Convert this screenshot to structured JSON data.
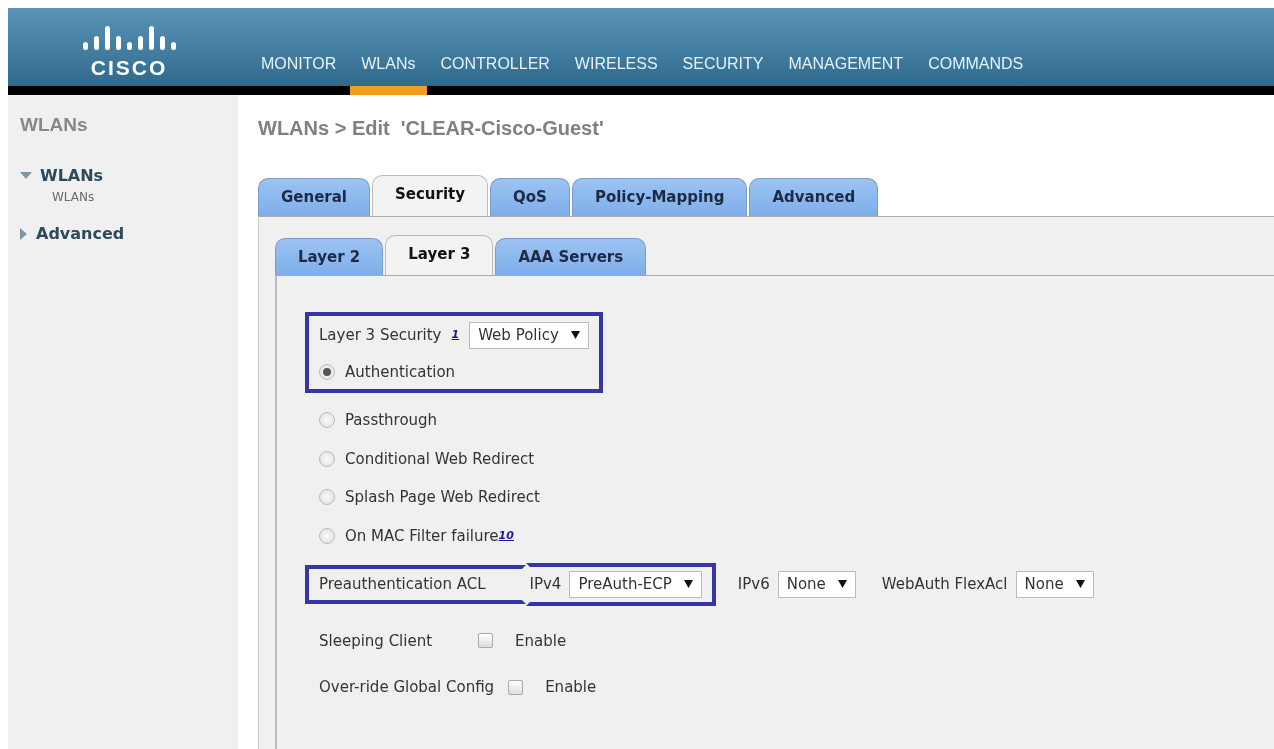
{
  "header": {
    "logo": "CISCO",
    "menu": [
      {
        "label": "MONITOR",
        "selected": false
      },
      {
        "label": "WLANs",
        "selected": true
      },
      {
        "label": "CONTROLLER",
        "selected": false
      },
      {
        "label": "WIRELESS",
        "selected": false
      },
      {
        "label": "SECURITY",
        "selected": false
      },
      {
        "label": "MANAGEMENT",
        "selected": false
      },
      {
        "label": "COMMANDS",
        "selected": false
      }
    ]
  },
  "sidebar": {
    "title": "WLANs",
    "items": [
      {
        "label": "WLANs",
        "expanded": true,
        "children": [
          {
            "label": "WLANs"
          }
        ]
      },
      {
        "label": "Advanced",
        "expanded": false
      }
    ]
  },
  "page_title": "WLANs > Edit  'CLEAR-Cisco-Guest'",
  "tabs": [
    {
      "label": "General",
      "selected": false
    },
    {
      "label": "Security",
      "selected": true
    },
    {
      "label": "QoS",
      "selected": false
    },
    {
      "label": "Policy-Mapping",
      "selected": false
    },
    {
      "label": "Advanced",
      "selected": false
    }
  ],
  "subtabs": [
    {
      "label": "Layer 2",
      "selected": false
    },
    {
      "label": "Layer 3",
      "selected": true
    },
    {
      "label": "AAA Servers",
      "selected": false
    }
  ],
  "form": [
    {
      "kind": "select",
      "label": "Layer 3 Security",
      "footnote": "1",
      "value": "Web Policy",
      "highlighted": true
    },
    {
      "kind": "radio",
      "label": "Authentication",
      "selected": true,
      "highlighted": true
    },
    {
      "kind": "radio",
      "label": "Passthrough",
      "selected": false,
      "highlighted": false
    },
    {
      "kind": "radio",
      "label": "Conditional Web Redirect",
      "selected": false,
      "highlighted": false
    },
    {
      "kind": "radio",
      "label": "Splash Page Web Redirect",
      "selected": false,
      "highlighted": false
    },
    {
      "kind": "radio",
      "label": "On MAC Filter failure",
      "footnote": "10",
      "selected": false,
      "highlighted": false
    },
    {
      "kind": "acl",
      "label": "Preauthentication ACL",
      "highlighted": true,
      "fields": [
        {
          "label": "IPv4",
          "value": "PreAuth-ECP",
          "highlighted": true
        },
        {
          "label": "IPv6",
          "value": "None",
          "highlighted": false
        },
        {
          "label": "WebAuth FlexAcl",
          "value": "None",
          "highlighted": false
        }
      ]
    },
    {
      "kind": "checkbox",
      "label": "Sleeping Client",
      "option": "Enable",
      "checked": false
    },
    {
      "kind": "checkbox",
      "label": "Over-ride Global Config",
      "option": "Enable",
      "checked": false
    }
  ]
}
